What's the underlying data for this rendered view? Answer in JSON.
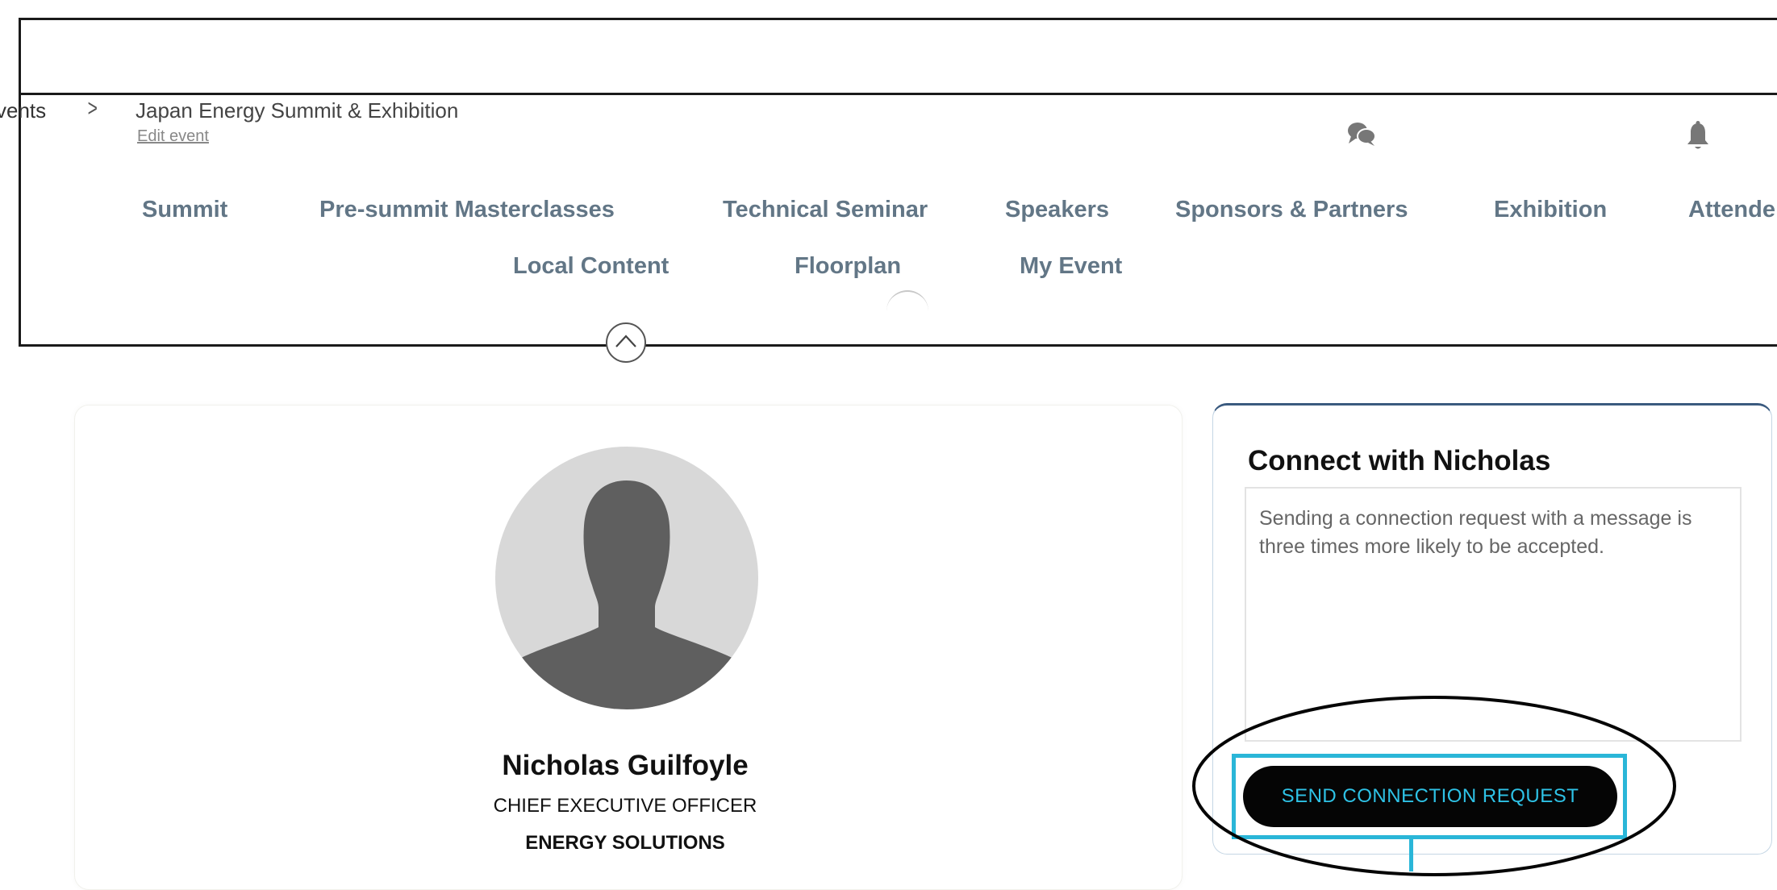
{
  "header": {
    "breadcrumb_prev": "vents",
    "event_title": "Japan Energy Summit & Exhibition",
    "edit_link": "Edit event",
    "icons": [
      "chat-bubbles-icon",
      "bell-icon"
    ]
  },
  "nav": {
    "row1": [
      "Summit",
      "Pre-summit Masterclasses",
      "Technical Seminar",
      "Speakers",
      "Sponsors & Partners",
      "Exhibition",
      "Attende"
    ],
    "row2": [
      "Local Content",
      "Floorplan",
      "My Event"
    ]
  },
  "profile": {
    "name": "Nicholas Guilfoyle",
    "title": "CHIEF EXECUTIVE OFFICER",
    "company": "ENERGY SOLUTIONS"
  },
  "connect": {
    "heading": "Connect with Nicholas",
    "message_placeholder": "Sending a connection request with a message is three times more likely to be accepted.",
    "message_value": "",
    "send_label": "SEND CONNECTION REQUEST"
  },
  "colors": {
    "nav_text": "#627686",
    "send_button_bg": "#050505",
    "send_button_text": "#2ec2e6",
    "highlight": "#2ab6d8",
    "connect_card_border": "#3a5a7f"
  }
}
